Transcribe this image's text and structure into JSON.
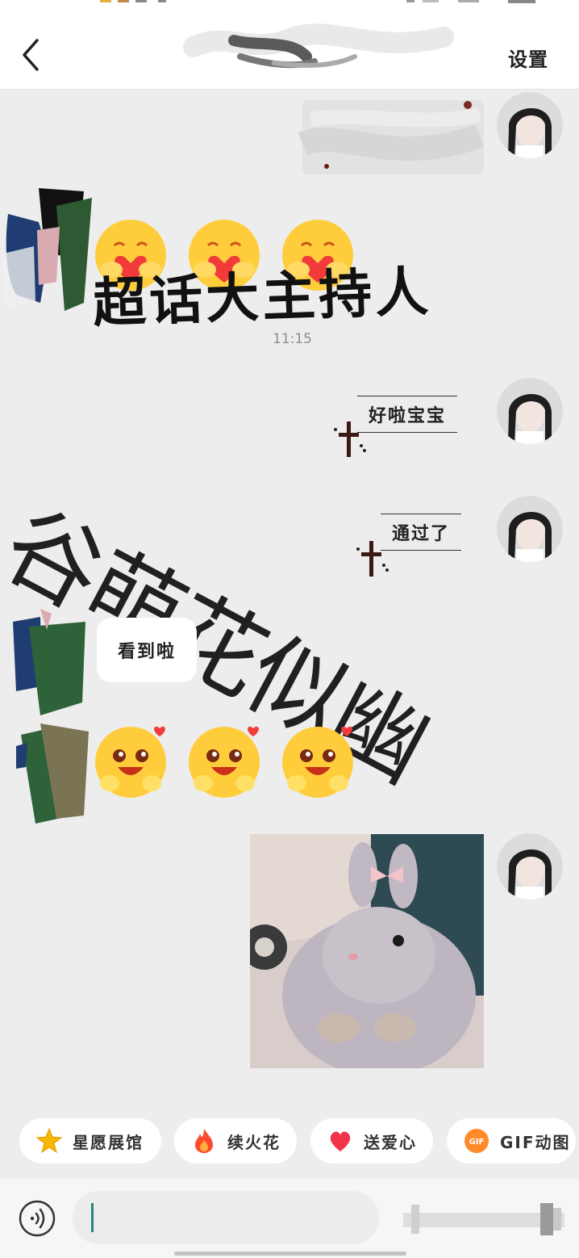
{
  "header": {
    "back_icon": "chevron-left-icon",
    "settings_label": "设置"
  },
  "chat": {
    "timestamp": "11:15",
    "messages": [
      {
        "side": "right",
        "type": "smudged-bubble"
      },
      {
        "side": "left",
        "type": "emoji-row",
        "emoji": "hugging-heart-emoji",
        "count": 3
      },
      {
        "side": "right",
        "type": "text",
        "text": "好啦宝宝"
      },
      {
        "side": "right",
        "type": "text",
        "text": "通过了"
      },
      {
        "side": "left",
        "type": "text",
        "text": "看到啦"
      },
      {
        "side": "left",
        "type": "emoji-row",
        "emoji": "excited-blush-emoji",
        "count": 3
      },
      {
        "side": "right",
        "type": "image",
        "image": "bunny-photo"
      }
    ],
    "overlay_text": {
      "line1": "超话大主持人",
      "line2": "谷萌花似幽"
    }
  },
  "quick_actions": [
    {
      "label": "星愿展馆",
      "icon": "star-icon",
      "color": "#f5b800"
    },
    {
      "label": "续火花",
      "icon": "flame-icon",
      "color": "#ff4a2e"
    },
    {
      "label": "送爱心",
      "icon": "heart-icon",
      "color": "#f2324a"
    },
    {
      "label": "GIF动图",
      "icon": "gif-icon",
      "color": "#ff8a2a"
    }
  ],
  "input": {
    "voice_icon": "voice-icon",
    "placeholder": ""
  }
}
